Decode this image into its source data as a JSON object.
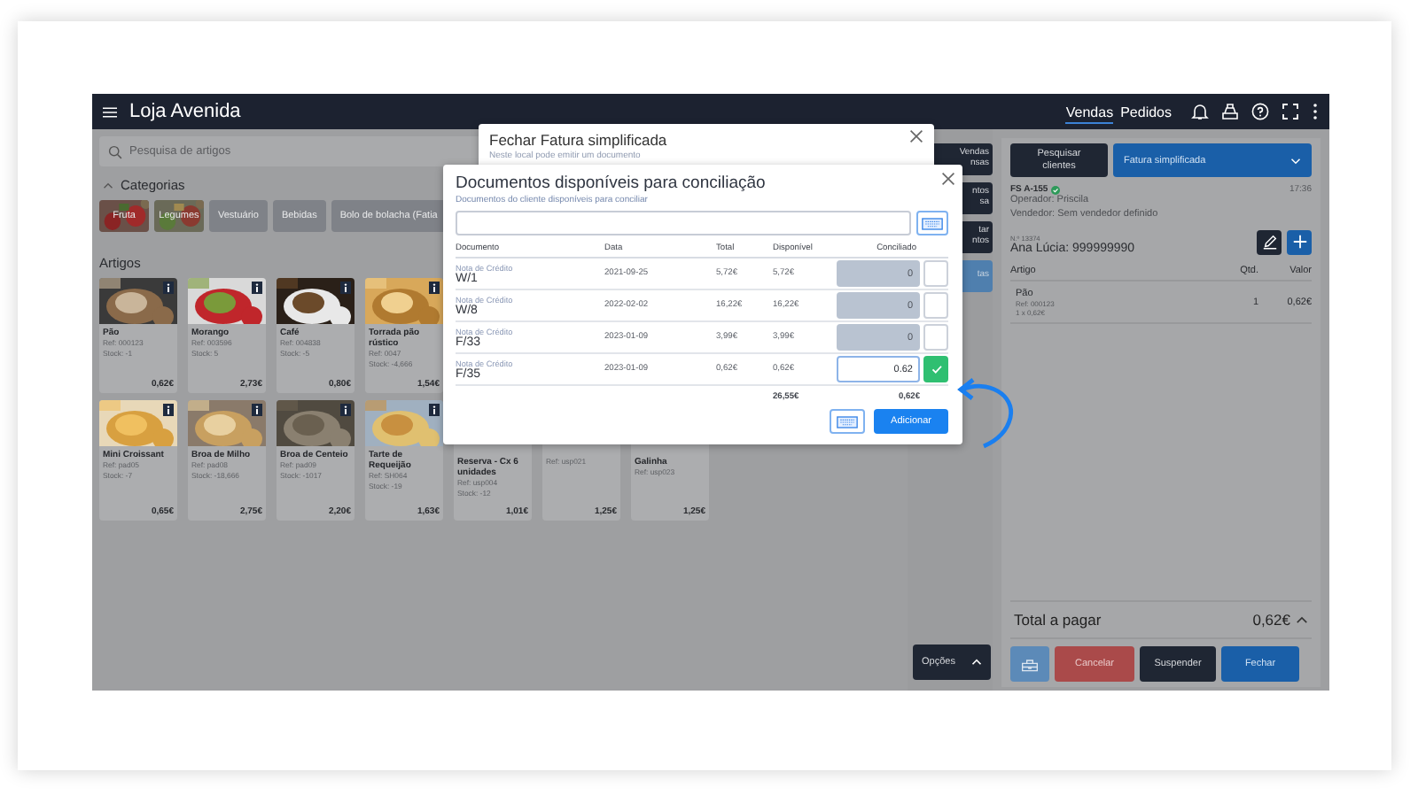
{
  "top_bar": {
    "title": "Loja Avenida",
    "nav": [
      {
        "label": "Vendas",
        "selected": true
      },
      {
        "label": "Pedidos",
        "selected": false
      }
    ]
  },
  "search": {
    "placeholder": "Pesquisa de artigos"
  },
  "categories": {
    "title": "Categorias",
    "expanded": true,
    "items": [
      {
        "label": "Fruta",
        "kind": "picture"
      },
      {
        "label": "Legumes",
        "kind": "picture"
      },
      {
        "label": "Vestuário",
        "kind": "plain"
      },
      {
        "label": "Bebidas",
        "kind": "plain"
      },
      {
        "label": "Bolo de bolacha (Fatia",
        "kind": "plain"
      }
    ]
  },
  "articles": {
    "title": "Artigos",
    "rows": [
      [
        {
          "name": "Pão",
          "ref": "Ref: 000123",
          "stock": "Stock: -1",
          "price": "0,62€",
          "photo": true
        },
        {
          "name": "Morango",
          "ref": "Ref: 003596",
          "stock": "Stock: 5",
          "price": "2,73€",
          "photo": true
        },
        {
          "name": "Café",
          "ref": "Ref: 004838",
          "stock": "Stock: -5",
          "price": "0,80€",
          "photo": true
        },
        {
          "name": "Torrada pão rústico",
          "ref": "Ref: 0047",
          "stock": "Stock: -4,666",
          "price": "1,54€",
          "photo": true
        }
      ],
      [
        {
          "name": "Mini Croissant",
          "ref": "Ref: pad05",
          "stock": "Stock: -7",
          "price": "0,65€",
          "photo": true
        },
        {
          "name": "Broa de Milho",
          "ref": "Ref: pad08",
          "stock": "Stock: -18,666",
          "price": "2,75€",
          "photo": true
        },
        {
          "name": "Broa de Centeio",
          "ref": "Ref: pad09",
          "stock": "Stock: -1017",
          "price": "2,20€",
          "photo": true
        },
        {
          "name": "Tarte de Requeijão",
          "ref": "Ref: SH064",
          "stock": "Stock: -19",
          "price": "1,63€",
          "photo": true
        },
        {
          "name": "Reserva - Cx 6 unidades",
          "ref": "Ref: usp004",
          "stock": "Stock: -12",
          "price": "1,01€",
          "photo": false
        },
        {
          "ref": "Ref: usp021",
          "price": "1,25€",
          "photo": false
        },
        {
          "name": "Galinha",
          "ref": "Ref: usp023",
          "price": "1,25€",
          "photo": false
        }
      ]
    ]
  },
  "side_buttons": [
    {
      "lines": [
        "Vendas",
        "nsas"
      ],
      "selected": false
    },
    {
      "lines": [
        "ntos",
        "sa"
      ],
      "selected": false
    },
    {
      "lines": [
        "tar",
        "ntos"
      ],
      "selected": false
    },
    {
      "lines": [
        "tas"
      ],
      "selected": true
    }
  ],
  "options_button": "Opções",
  "sale": {
    "search_client": "Pesquisar clientes",
    "doc_type": "Fatura simplificada",
    "doc_number": "FS A-155",
    "time": "17:36",
    "operator": "Operador: Priscila",
    "seller": "Vendedor: Sem vendedor definido",
    "client_no": "N.º 13374",
    "client": "Ana Lúcia: 999999990",
    "columns": [
      "Artigo",
      "Qtd.",
      "Valor"
    ],
    "lines": [
      {
        "name": "Pão",
        "ref": "Ref: 000123",
        "detail": "1 x 0,62€",
        "qty": "1",
        "value": "0,62€"
      }
    ],
    "total_label": "Total a pagar",
    "total": "0,62€",
    "actions": [
      {
        "kind": "icon"
      },
      {
        "kind": "danger",
        "label": "Cancelar"
      },
      {
        "kind": "dark",
        "label": "Suspender"
      },
      {
        "kind": "primary",
        "label": "Fechar"
      }
    ]
  },
  "close_dialog": {
    "title": "Fechar Fatura simplificada",
    "subtitle": "Neste local pode emitir um documento"
  },
  "reconcile_dialog": {
    "title": "Documentos disponíveis para conciliação",
    "subtitle": "Documentos do cliente disponíveis para conciliar",
    "columns": [
      "Documento",
      "Data",
      "Total",
      "Disponível",
      "Conciliado"
    ],
    "rows": [
      {
        "type": "Nota de Crédito",
        "number": "W/1",
        "date": "2021-09-25",
        "total": "5,72€",
        "available": "5,72€",
        "reconciled": "0",
        "checked": false
      },
      {
        "type": "Nota de Crédito",
        "number": "W/8",
        "date": "2022-02-02",
        "total": "16,22€",
        "available": "16,22€",
        "reconciled": "0",
        "checked": false
      },
      {
        "type": "Nota de Crédito",
        "number": "F/33",
        "date": "2023-01-09",
        "total": "3,99€",
        "available": "3,99€",
        "reconciled": "0",
        "checked": false
      },
      {
        "type": "Nota de Crédito",
        "number": "F/35",
        "date": "2023-01-09",
        "total": "0,62€",
        "available": "0,62€",
        "reconciled": "0.62",
        "checked": true
      }
    ],
    "total_available": "26,55€",
    "total_reconciled": "0,62€",
    "add_button": "Adicionar"
  }
}
